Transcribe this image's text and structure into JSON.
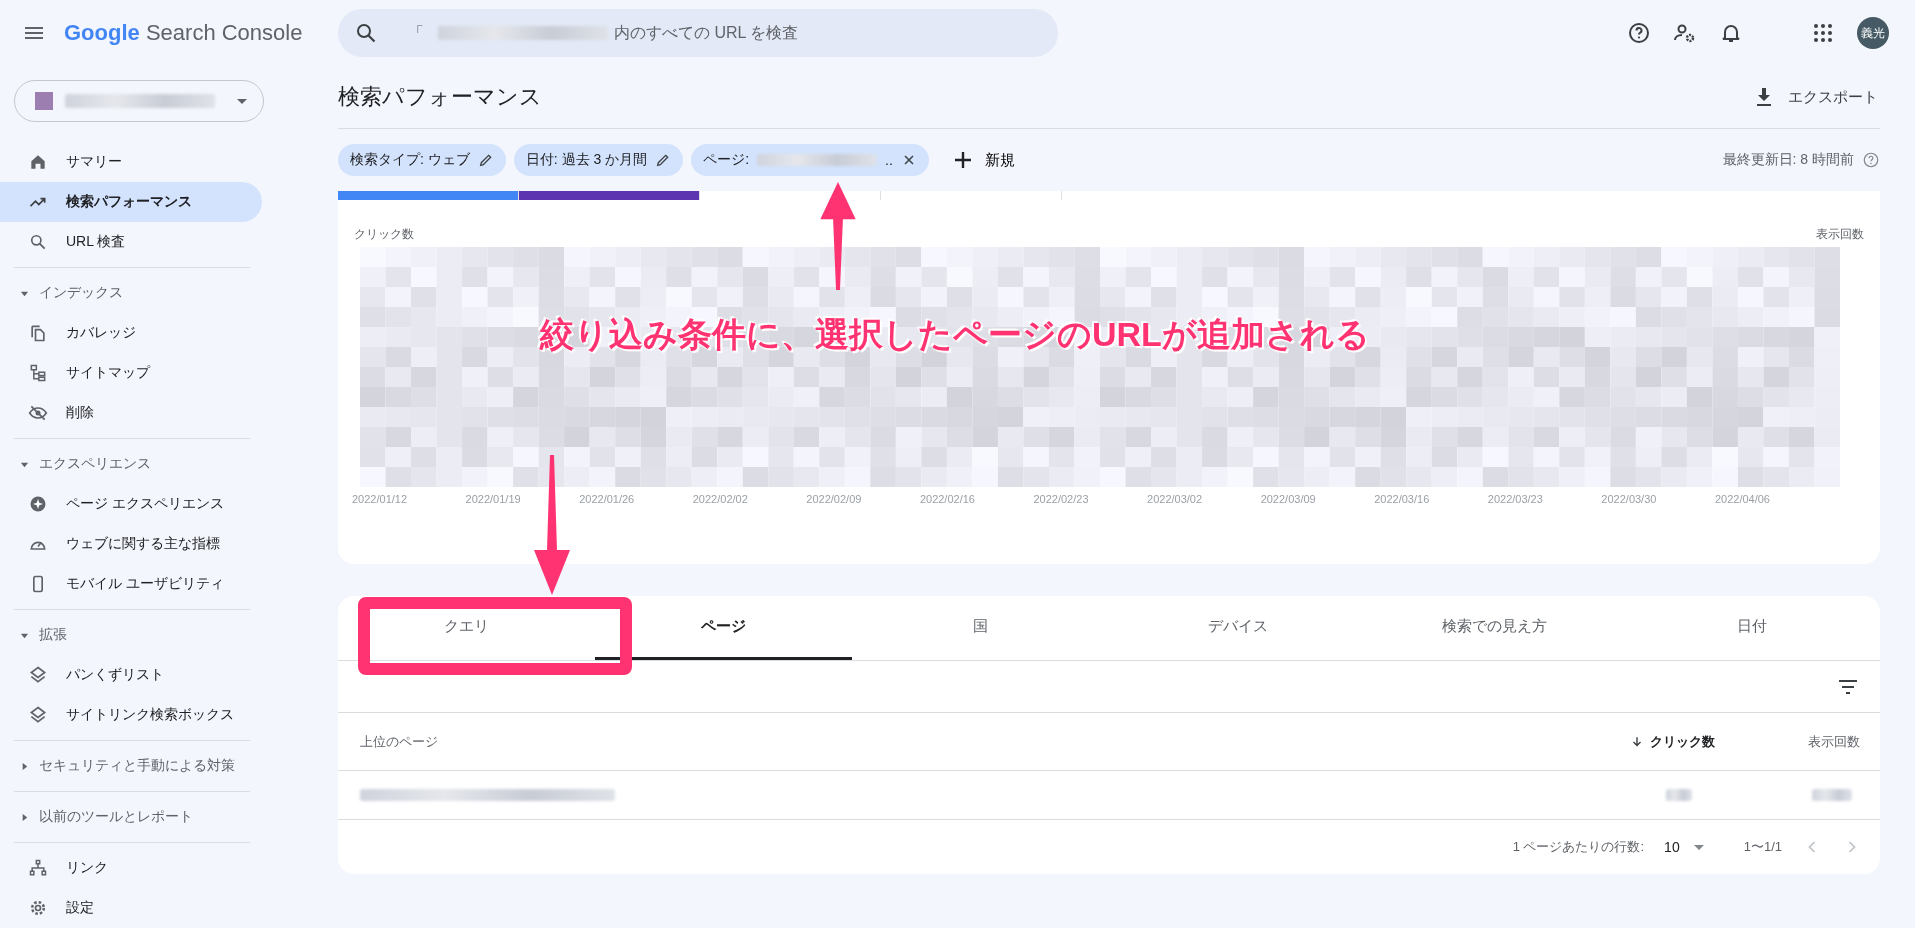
{
  "header": {
    "product": {
      "google": "Google",
      "name": "Search Console"
    },
    "search": {
      "prefix": "「",
      "suffix": "内のすべての URL を検査"
    },
    "avatar": "義光"
  },
  "sidebar": {
    "nav": [
      {
        "label": "サマリー",
        "selected": false
      },
      {
        "label": "検索パフォーマンス",
        "selected": true
      },
      {
        "label": "URL 検査",
        "selected": false
      }
    ],
    "sections": [
      {
        "title": "インデックス",
        "expanded": true,
        "items": [
          {
            "label": "カバレッジ",
            "selected": false
          },
          {
            "label": "サイトマップ",
            "selected": false
          },
          {
            "label": "削除",
            "selected": false
          }
        ]
      },
      {
        "title": "エクスペリエンス",
        "expanded": true,
        "items": [
          {
            "label": "ページ エクスペリエンス",
            "selected": false
          },
          {
            "label": "ウェブに関する主な指標",
            "selected": false
          },
          {
            "label": "モバイル ユーザビリティ",
            "selected": false
          }
        ]
      },
      {
        "title": "拡張",
        "expanded": true,
        "items": [
          {
            "label": "パンくずリスト",
            "selected": false
          },
          {
            "label": "サイトリンク検索ボックス",
            "selected": false
          }
        ]
      },
      {
        "title": "セキュリティと手動による対策",
        "expanded": false
      },
      {
        "title": "以前のツールとレポート",
        "expanded": false
      }
    ],
    "footer_items": [
      {
        "label": "リンク",
        "selected": false
      },
      {
        "label": "設定",
        "selected": false
      }
    ]
  },
  "page": {
    "title": "検索パフォーマンス",
    "export": "エクスポート",
    "last_updated": "最終更新日: 8 時間前"
  },
  "filters": [
    {
      "label": "検索タイプ: ウェブ",
      "kind": "edit"
    },
    {
      "label": "日付: 過去 3 か月間",
      "kind": "edit"
    },
    {
      "label": "ページ:",
      "tail": "..",
      "kind": "remove"
    }
  ],
  "new_filter": "新規",
  "metric_cards": [
    {
      "selected": true,
      "color": "#4285f4"
    },
    {
      "selected": true,
      "color": "#5e35b1"
    },
    {
      "selected": false
    },
    {
      "selected": false
    }
  ],
  "chart": {
    "left_label": "クリック数",
    "right_label": "表示回数",
    "x_labels": [
      "2022/01/12",
      "2022/01/19",
      "2022/01/26",
      "2022/02/02",
      "2022/02/09",
      "2022/02/16",
      "2022/02/23",
      "2022/03/02",
      "2022/03/09",
      "2022/03/16",
      "2022/03/23",
      "2022/03/30",
      "2022/04/06"
    ]
  },
  "tabs": [
    {
      "label": "クエリ",
      "selected": false
    },
    {
      "label": "ページ",
      "selected": true
    },
    {
      "label": "国",
      "selected": false
    },
    {
      "label": "デバイス",
      "selected": false
    },
    {
      "label": "検索での見え方",
      "selected": false
    },
    {
      "label": "日付",
      "selected": false
    }
  ],
  "table": {
    "columns": [
      {
        "label": "上位のページ",
        "sorted": false
      },
      {
        "label": "クリック数",
        "sorted": true
      },
      {
        "label": "表示回数",
        "sorted": false
      }
    ]
  },
  "pagination": {
    "rows_label": "1 ページあたりの行数:",
    "rows_value": "10",
    "range": "1〜1/1"
  },
  "annotation": {
    "callout": "絞り込み条件に、選択したページのURLが追加される"
  }
}
